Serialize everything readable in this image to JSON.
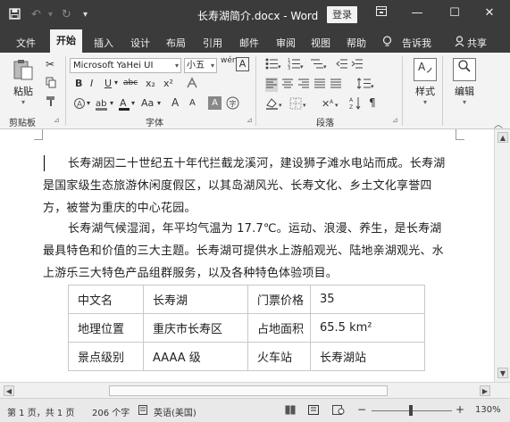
{
  "titlebar": {
    "save_icon": "save-icon",
    "undo_icon": "undo-icon",
    "redo_icon": "redo-icon",
    "customize_icon": "customize-quick-access-icon",
    "title": "长寿湖简介.docx - Word",
    "login": "登录",
    "ribbon_display_icon": "ribbon-display-options-icon",
    "minimize": "—",
    "maximize": "☐",
    "close": "✕"
  },
  "tabs": {
    "file": "文件",
    "home": "开始",
    "insert": "插入",
    "design": "设计",
    "layout": "布局",
    "references": "引用",
    "mailings": "邮件",
    "review": "审阅",
    "view": "视图",
    "help": "帮助",
    "tell_me": "告诉我",
    "share": "共享"
  },
  "ribbon": {
    "clipboard": {
      "paste": "粘贴",
      "label": "剪贴板"
    },
    "font": {
      "font_name": "Microsoft YaHei UI",
      "font_size": "小五",
      "bold": "B",
      "italic": "I",
      "underline": "U",
      "strike": "abc",
      "subscript": "x₂",
      "superscript": "x²",
      "grow": "A",
      "shrink": "A",
      "case": "Aa",
      "label": "字体"
    },
    "paragraph": {
      "label": "段落"
    },
    "styles": {
      "label": "样式"
    },
    "editing": {
      "label": "编辑"
    }
  },
  "document": {
    "paragraphs": [
      [
        "长寿湖因二十世纪五十年代拦截龙溪河，建设狮子滩水电站而成。长寿湖",
        "是国家级生态旅游休闲度假区，以其岛湖风光、长寿文化、乡土文化享誉四",
        "方，被誉为重庆的中心花园。"
      ],
      [
        "长寿湖气候湿润，年平均气温为 17.7℃。运动、浪漫、养生，是长寿湖",
        "最具特色和价值的三大主题。长寿湖可提供水上游船观光、陆地亲湖观光、水",
        "上游乐三大特色产品组群服务，以及各种特色体验项目。"
      ]
    ],
    "table": [
      [
        "中文名",
        "长寿湖",
        "门票价格",
        "35"
      ],
      [
        "地理位置",
        "重庆市长寿区",
        "占地面积",
        "65.5 km²"
      ],
      [
        "景点级别",
        "AAAA 级",
        "火车站",
        "长寿湖站"
      ]
    ]
  },
  "statusbar": {
    "page": "第 1 页，共 1 页",
    "words": "206 个字",
    "language": "英语(美国)",
    "zoom_minus": "−",
    "zoom_plus": "+",
    "zoom": "130%"
  }
}
